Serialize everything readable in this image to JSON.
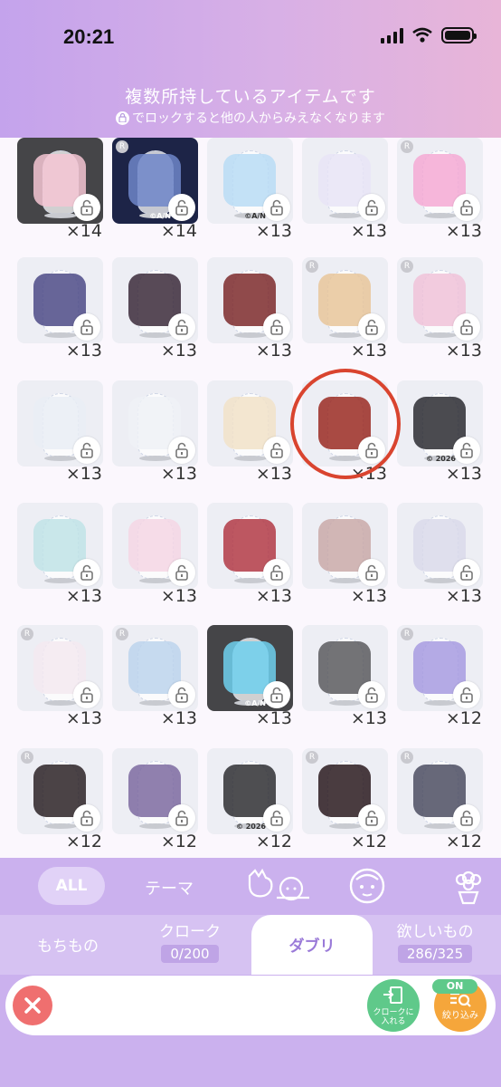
{
  "status_bar": {
    "time": "20:21"
  },
  "header": {
    "title": "複数所持しているアイテムです",
    "subtitle": "でロックすると他の人からみえなくなります"
  },
  "grid": {
    "rows": [
      {
        "counts": [
          "×14",
          "×14",
          "×13",
          "×13",
          "×13"
        ],
        "items": [
          {
            "bg": "dark",
            "color": "#f4c6d3",
            "badge": false,
            "copyright": ""
          },
          {
            "bg": "navy",
            "color": "#6f86c9",
            "badge": true,
            "copyright": "©A/N"
          },
          {
            "bg": "light",
            "color": "#b9dcf4",
            "badge": false,
            "copyright": "©A/N"
          },
          {
            "bg": "light",
            "color": "#e8e4f6",
            "badge": false,
            "copyright": ""
          },
          {
            "bg": "light",
            "color": "#f5a9d4",
            "badge": true,
            "copyright": ""
          }
        ]
      },
      {
        "counts": [
          "×13",
          "×13",
          "×13",
          "×13",
          "×13"
        ],
        "items": [
          {
            "bg": "light",
            "color": "#4c4a86",
            "badge": false,
            "copyright": ""
          },
          {
            "bg": "light",
            "color": "#3b2a3a",
            "badge": false,
            "copyright": ""
          },
          {
            "bg": "light",
            "color": "#7c2a2c",
            "badge": false,
            "copyright": ""
          },
          {
            "bg": "light",
            "color": "#e8c59a",
            "badge": true,
            "copyright": ""
          },
          {
            "bg": "light",
            "color": "#f0c2d8",
            "badge": true,
            "copyright": ""
          }
        ]
      },
      {
        "counts": [
          "×13",
          "×13",
          "×13",
          "×13",
          "×13"
        ],
        "items": [
          {
            "bg": "light",
            "color": "#e9edf5",
            "badge": false,
            "copyright": ""
          },
          {
            "bg": "light",
            "color": "#eef1f6",
            "badge": false,
            "copyright": ""
          },
          {
            "bg": "light",
            "color": "#f1e2c8",
            "badge": false,
            "copyright": ""
          },
          {
            "bg": "light",
            "color": "#9a2a22",
            "badge": false,
            "copyright": ""
          },
          {
            "bg": "light",
            "color": "#2b2b31",
            "badge": false,
            "copyright": "© 2026"
          }
        ]
      },
      {
        "counts": [
          "×13",
          "×13",
          "×13",
          "×13",
          "×13"
        ],
        "items": [
          {
            "bg": "light",
            "color": "#bfe3e6",
            "badge": false,
            "copyright": ""
          },
          {
            "bg": "light",
            "color": "#f4d6e4",
            "badge": false,
            "copyright": ""
          },
          {
            "bg": "light",
            "color": "#b23a45",
            "badge": false,
            "copyright": ""
          },
          {
            "bg": "light",
            "color": "#c9a9a8",
            "badge": false,
            "copyright": ""
          },
          {
            "bg": "light",
            "color": "#d9d9ea",
            "badge": false,
            "copyright": ""
          }
        ]
      },
      {
        "counts": [
          "×13",
          "×13",
          "×13",
          "×13",
          "×12"
        ],
        "items": [
          {
            "bg": "light",
            "color": "#f3e9f0",
            "badge": true,
            "copyright": ""
          },
          {
            "bg": "light",
            "color": "#bcd3ec",
            "badge": true,
            "copyright": ""
          },
          {
            "bg": "dark",
            "color": "#6fd0ee",
            "badge": false,
            "copyright": "©A/N"
          },
          {
            "bg": "light",
            "color": "#5a5a5e",
            "badge": false,
            "copyright": ""
          },
          {
            "bg": "light",
            "color": "#a79be0",
            "badge": true,
            "copyright": ""
          }
        ]
      },
      {
        "counts": [
          "×12",
          "×12",
          "×12",
          "×12",
          "×12"
        ],
        "items": [
          {
            "bg": "light",
            "color": "#2b2226",
            "badge": true,
            "copyright": ""
          },
          {
            "bg": "light",
            "color": "#7d6aa0",
            "badge": false,
            "copyright": ""
          },
          {
            "bg": "light",
            "color": "#2f2f33",
            "badge": false,
            "copyright": "© 2026"
          },
          {
            "bg": "light",
            "color": "#2a1a1f",
            "badge": true,
            "copyright": ""
          },
          {
            "bg": "light",
            "color": "#4c4d62",
            "badge": true,
            "copyright": ""
          }
        ]
      }
    ]
  },
  "filter_tabs": {
    "all": "ALL",
    "theme": "テーマ"
  },
  "segments": {
    "mochimono": "もちもの",
    "cloak": "クローク",
    "cloak_count": "0/200",
    "daburi": "ダブリ",
    "wishlist": "欲しいもの",
    "wishlist_count": "286/325"
  },
  "actions": {
    "cloak_line1": "クロークに",
    "cloak_line2": "入れる",
    "filter_label": "絞り込み",
    "filter_state": "ON"
  },
  "colors": {
    "accent_purple": "#cbb1ee",
    "close_red": "#ef6f6f",
    "green": "#5fc98a",
    "orange": "#f5a63b",
    "highlight": "#d9442f"
  }
}
